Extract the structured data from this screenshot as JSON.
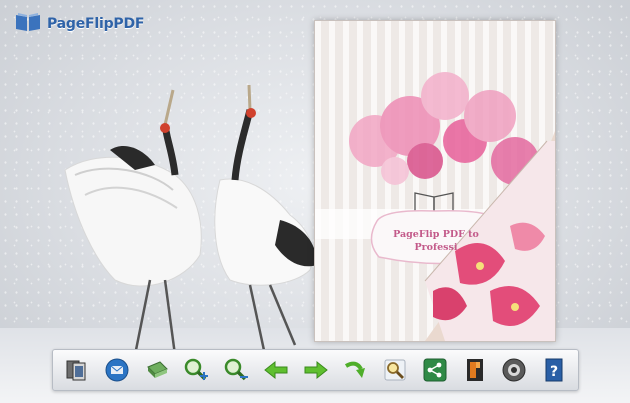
{
  "app": {
    "logo_text": "PageFlipPDF"
  },
  "book": {
    "cover_title_line1": "PageFlip PDF to",
    "cover_title_line2": "Professi"
  },
  "toolbar": {
    "buttons": [
      {
        "name": "pages",
        "icon": "pages-icon"
      },
      {
        "name": "share",
        "icon": "email-icon"
      },
      {
        "name": "print",
        "icon": "print-icon"
      },
      {
        "name": "zoom-in",
        "icon": "zoom-in-icon"
      },
      {
        "name": "zoom-out",
        "icon": "zoom-out-icon"
      },
      {
        "name": "previous-page",
        "icon": "arrow-left-icon"
      },
      {
        "name": "next-page",
        "icon": "arrow-right-icon"
      },
      {
        "name": "auto-flip",
        "icon": "flip-icon"
      },
      {
        "name": "search",
        "icon": "search-icon"
      },
      {
        "name": "social-share",
        "icon": "share-icon"
      },
      {
        "name": "fullscreen",
        "icon": "fullscreen-icon"
      },
      {
        "name": "sound",
        "icon": "sound-icon"
      },
      {
        "name": "help",
        "icon": "help-icon"
      }
    ]
  },
  "colors": {
    "accent": "#2f63a8",
    "toolbar_bg": "#e6e8ec",
    "cover_pink": "#e8609a"
  }
}
